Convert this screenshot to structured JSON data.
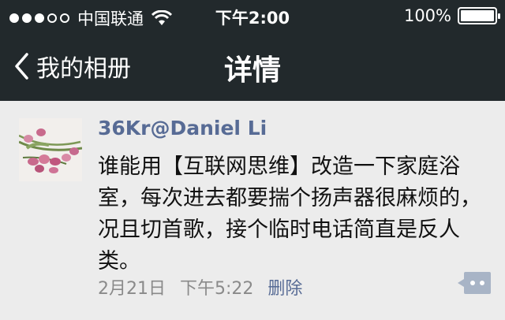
{
  "status_bar": {
    "carrier": "中国联通",
    "time": "下午2:00",
    "battery": "100%",
    "battery_level": 1.0,
    "signal_bars_filled": 3,
    "signal_bars_total": 5
  },
  "nav": {
    "back_label": "我的相册",
    "title": "详情"
  },
  "post": {
    "username": "36Kr@Daniel Li",
    "text": "谁能用【互联网思维】改造一下家庭浴室，每次进去都要揣个扬声器很麻烦的，况且切首歌，接个临时电话简直是反人类。",
    "date": "2月21日",
    "time": "下午5:22",
    "delete_label": "删除"
  },
  "colors": {
    "bar_bg": "#22292c",
    "link": "#576b95",
    "page_bg": "#ececec"
  }
}
